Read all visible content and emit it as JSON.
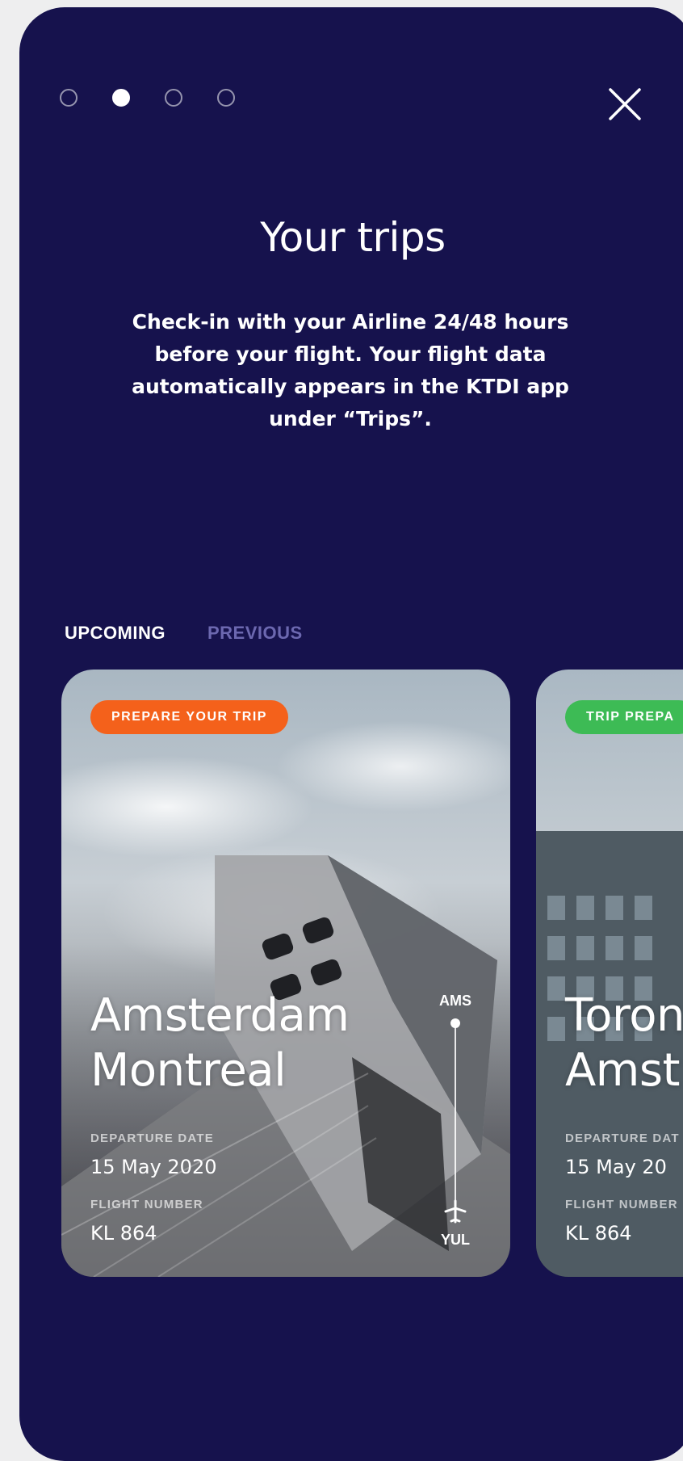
{
  "pager": {
    "total": 4,
    "active_index": 1
  },
  "header": {
    "title": "Your trips",
    "description": "Check-in with your Airline 24/48 hours before your flight. Your flight data automatically appears in the KTDI app under “Trips”."
  },
  "tabs": [
    {
      "label": "UPCOMING",
      "active": true
    },
    {
      "label": "PREVIOUS",
      "active": false
    }
  ],
  "trips": [
    {
      "badge": "PREPARE YOUR TRIP",
      "badge_color": "#f4611b",
      "from_city": "Amsterdam",
      "to_city": "Montreal",
      "departure_label": "DEPARTURE DATE",
      "departure_date": "15 May 2020",
      "flight_label": "FLIGHT NUMBER",
      "flight_number": "KL 864",
      "from_code": "AMS",
      "to_code": "YUL"
    },
    {
      "badge": "TRIP PREPA",
      "badge_color": "#3dbb55",
      "from_city": "Toron",
      "to_city": "Amst",
      "departure_label": "DEPARTURE DAT",
      "departure_date": "15 May 20",
      "flight_label": "FLIGHT NUMBER",
      "flight_number": "KL 864"
    }
  ],
  "colors": {
    "background": "#16124d",
    "tab_inactive": "#6c68b0"
  },
  "icons": {
    "close": "close-icon",
    "plane": "plane-icon"
  }
}
